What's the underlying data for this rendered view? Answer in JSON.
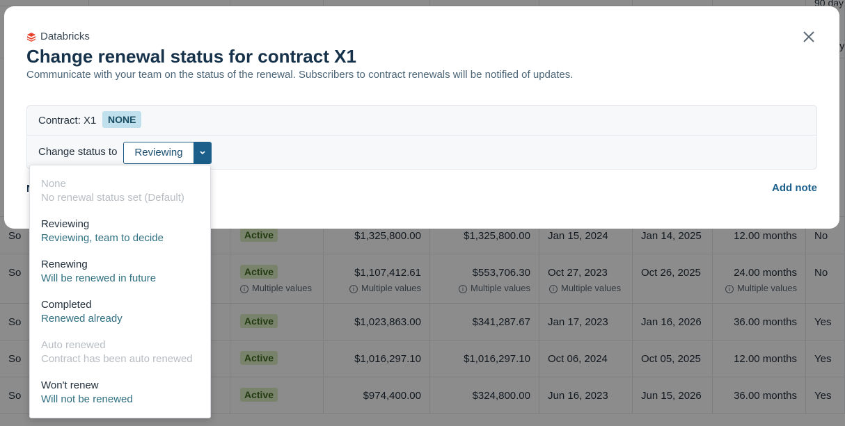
{
  "modal": {
    "brand": "Databricks",
    "title": "Change renewal status for contract X1",
    "subtitle": "Communicate with your team on the status of the renewal. Subscribers to contract renewals will be notified of updates.",
    "contract_label": "Contract: X1",
    "current_status_badge": "NONE",
    "change_status_label": "Change status to",
    "selected_status": "Reviewing",
    "add_note_label": "Add note",
    "clipped_left_text": "N"
  },
  "dropdown": {
    "options": [
      {
        "title": "None",
        "description": "No renewal status set (Default)",
        "disabled": true
      },
      {
        "title": "Reviewing",
        "description": "Reviewing, team to decide",
        "disabled": false
      },
      {
        "title": "Renewing",
        "description": "Will be renewed in future",
        "disabled": false
      },
      {
        "title": "Completed",
        "description": "Renewed already",
        "disabled": false
      },
      {
        "title": "Auto renewed",
        "description": "Contract has been auto renewed",
        "disabled": true
      },
      {
        "title": "Won't renew",
        "description": "Will not be renewed",
        "disabled": false
      }
    ]
  },
  "background_table": {
    "top_right_fragment": "90 day",
    "right_edge_fragment": "y",
    "multiple_values_label": "Multiple values",
    "rows": [
      {
        "name": "So",
        "status": "Active",
        "total": "$1,325,800.00",
        "annual": "$1,325,800.00",
        "start": "Jan 15, 2024",
        "end": "Jan 14, 2025",
        "term": "12.00 months",
        "flag": "No",
        "multi": false
      },
      {
        "name": "So",
        "status": "Active",
        "total": "$1,107,412.61",
        "annual": "$553,706.30",
        "start": "Oct 27, 2023",
        "end": "Oct 26, 2025",
        "term": "24.00 months",
        "flag": "No",
        "multi": true
      },
      {
        "name": "So",
        "status": "Active",
        "total": "$1,023,863.00",
        "annual": "$341,287.67",
        "start": "Jan 17, 2023",
        "end": "Jan 16, 2026",
        "term": "36.00 months",
        "flag": "Yes",
        "multi": false
      },
      {
        "name": "So",
        "status": "Active",
        "total": "$1,016,297.10",
        "annual": "$1,016,297.10",
        "start": "Oct 06, 2024",
        "end": "Oct 05, 2025",
        "term": "12.00 months",
        "flag": "Yes",
        "multi": false
      },
      {
        "name": "So",
        "status": "Active",
        "total": "$974,400.00",
        "annual": "$324,800.00",
        "start": "Jun 16, 2023",
        "end": "Jun 15, 2026",
        "term": "36.00 months",
        "flag": "Yes",
        "multi": false
      }
    ]
  }
}
